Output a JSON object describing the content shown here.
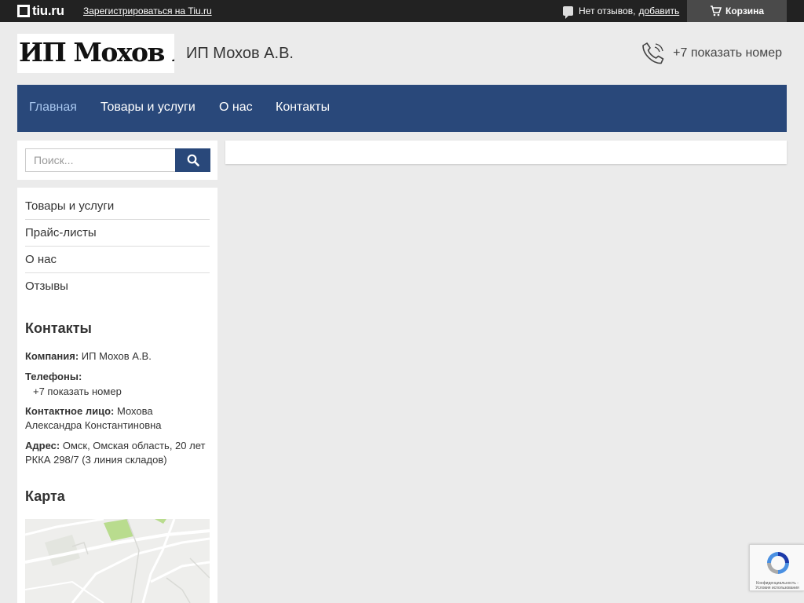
{
  "topbar": {
    "logo_text": "tiu.ru",
    "register_link": "Зарегистрироваться на Tiu.ru",
    "reviews_text": "Нет отзывов,",
    "reviews_add": "добавить",
    "cart_label": "Корзина"
  },
  "header": {
    "logo_text": "ИП Мохов А.В.",
    "company_name": "ИП Мохов А.В.",
    "phone": "+7 показать номер"
  },
  "nav": {
    "items": [
      "Главная",
      "Товары и услуги",
      "О нас",
      "Контакты"
    ],
    "active": "Главная"
  },
  "search": {
    "placeholder": "Поиск..."
  },
  "sidebar": {
    "menu": [
      "Товары и услуги",
      "Прайс-листы",
      "О нас",
      "Отзывы"
    ],
    "contacts_title": "Контакты",
    "company_label": "Компания:",
    "company_value": "ИП Мохов А.В.",
    "phones_label": "Телефоны:",
    "phones_value": "+7 показать номер",
    "person_label": "Контактное лицо:",
    "person_value": "Мохова Александра Константиновна",
    "address_label": "Адрес:",
    "address_value": "Омск, Омская область, 20 лет РККА 298/7 (3 линия складов)",
    "map_title": "Карта"
  },
  "recaptcha": {
    "text": "Конфиденциальность - Условия использования"
  },
  "colors": {
    "topbar_bg": "#222222",
    "nav_bg": "#29487a",
    "nav_active": "#a9c8f0",
    "page_bg": "#ebebeb"
  }
}
